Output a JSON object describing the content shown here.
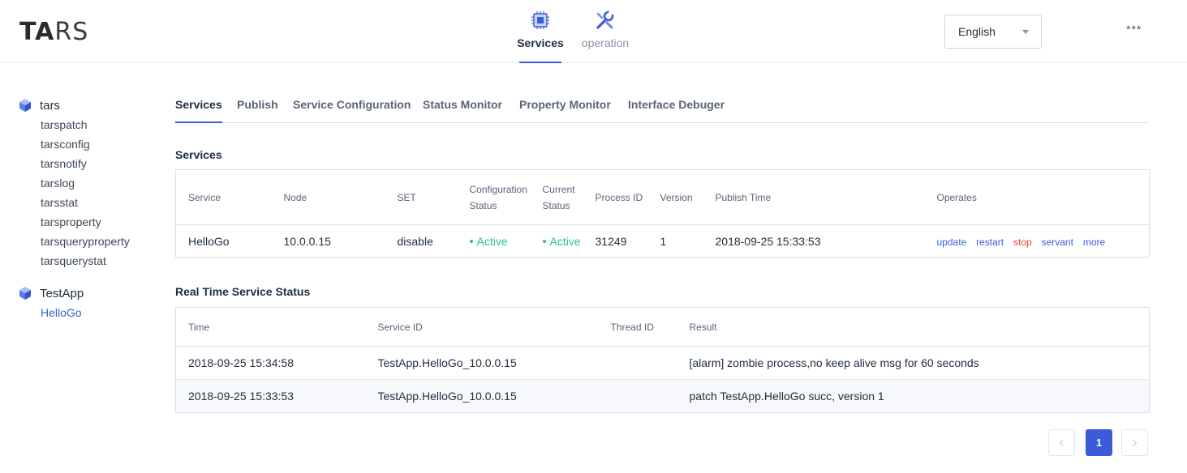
{
  "header": {
    "logo_bold": "TA",
    "logo_thin": "RS",
    "nav": [
      {
        "label": "Services",
        "icon": "chip-icon",
        "active": true
      },
      {
        "label": "operation",
        "icon": "wrench-icon",
        "active": false
      }
    ],
    "language": {
      "selected": "English"
    },
    "user_menu": "***"
  },
  "sidebar": {
    "apps": [
      {
        "name": "tars",
        "servers": [
          "tarspatch",
          "tarsconfig",
          "tarsnotify",
          "tarslog",
          "tarsstat",
          "tarsproperty",
          "tarsqueryproperty",
          "tarsquerystat"
        ]
      },
      {
        "name": "TestApp",
        "servers": [
          "HelloGo"
        ],
        "selected_server": "HelloGo"
      }
    ]
  },
  "tabs": [
    "Services",
    "Publish",
    "Service Configuration",
    "Status Monitor",
    "Property Monitor",
    "Interface Debuger"
  ],
  "services_section": {
    "title": "Services",
    "columns": [
      "Service",
      "Node",
      "SET",
      "Configuration Status",
      "Current Status",
      "Process ID",
      "Version",
      "Publish Time",
      "Operates"
    ],
    "rows": [
      {
        "service": "HelloGo",
        "node": "10.0.0.15",
        "set": "disable",
        "config_status": "Active",
        "current_status": "Active",
        "process_id": "31249",
        "version": "1",
        "publish_time": "2018-09-25 15:33:53",
        "operates": [
          "update",
          "restart",
          "stop",
          "servant",
          "more"
        ]
      }
    ]
  },
  "realtime_section": {
    "title": "Real Time Service Status",
    "columns": [
      "Time",
      "Service ID",
      "Thread ID",
      "Result"
    ],
    "rows": [
      {
        "time": "2018-09-25 15:34:58",
        "service_id": "TestApp.HelloGo_10.0.0.15",
        "thread_id": "",
        "result": "[alarm] zombie process,no keep alive msg for 60 seconds"
      },
      {
        "time": "2018-09-25 15:33:53",
        "service_id": "TestApp.HelloGo_10.0.0.15",
        "thread_id": "",
        "result": "patch TestApp.HelloGo succ, version 1"
      }
    ]
  },
  "pagination": {
    "current_page": "1"
  },
  "colors": {
    "accent": "#3b5bdb",
    "active_status": "#2ec27e",
    "danger": "#e8452e"
  }
}
